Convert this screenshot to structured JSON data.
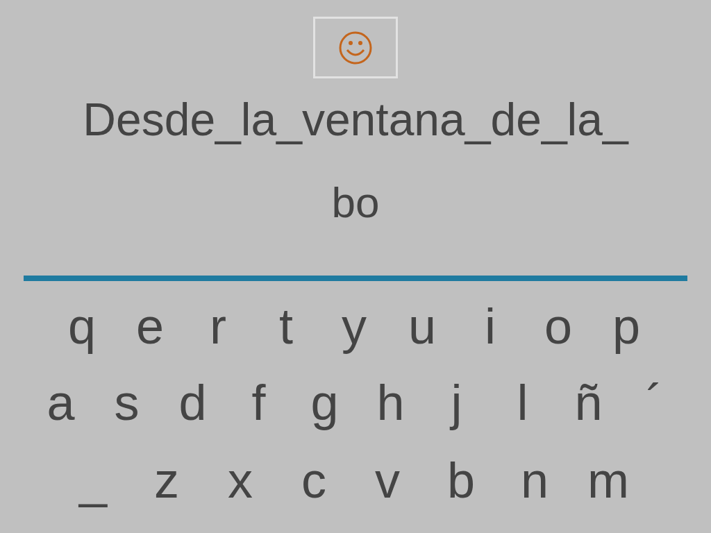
{
  "prompt": {
    "text": "Desde_la_ventana_de_la_"
  },
  "answer": {
    "value": "bo"
  },
  "keyboard": {
    "rows": [
      {
        "keys": [
          "q",
          "e",
          "r",
          "t",
          "y",
          "u",
          "i",
          "o",
          "p"
        ]
      },
      {
        "keys": [
          "a",
          "s",
          "d",
          "f",
          "g",
          "h",
          "j",
          "l",
          "ñ",
          "´"
        ]
      },
      {
        "keys": [
          "_",
          "z",
          "x",
          "c",
          "v",
          "b",
          "n",
          "m"
        ]
      }
    ]
  }
}
